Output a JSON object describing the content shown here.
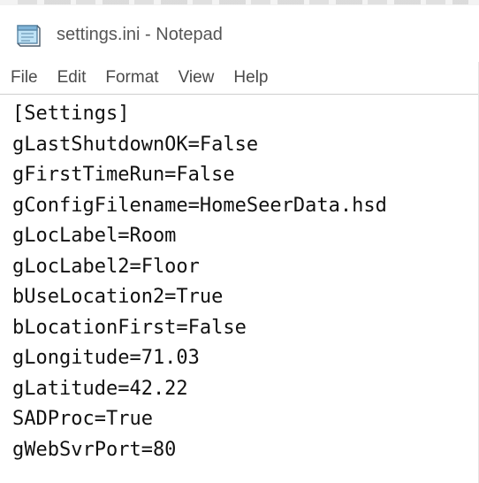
{
  "window": {
    "title": "settings.ini - Notepad",
    "icon": "notepad-icon"
  },
  "menu": {
    "items": [
      "File",
      "Edit",
      "Format",
      "View",
      "Help"
    ]
  },
  "editor": {
    "lines": [
      "[Settings]",
      "gLastShutdownOK=False",
      "gFirstTimeRun=False",
      "gConfigFilename=HomeSeerData.hsd",
      "gLocLabel=Room",
      "gLocLabel2=Floor",
      "bUseLocation2=True",
      "bLocationFirst=False",
      "gLongitude=71.03",
      "gLatitude=42.22",
      "SADProc=True",
      "gWebSvrPort=80"
    ]
  }
}
